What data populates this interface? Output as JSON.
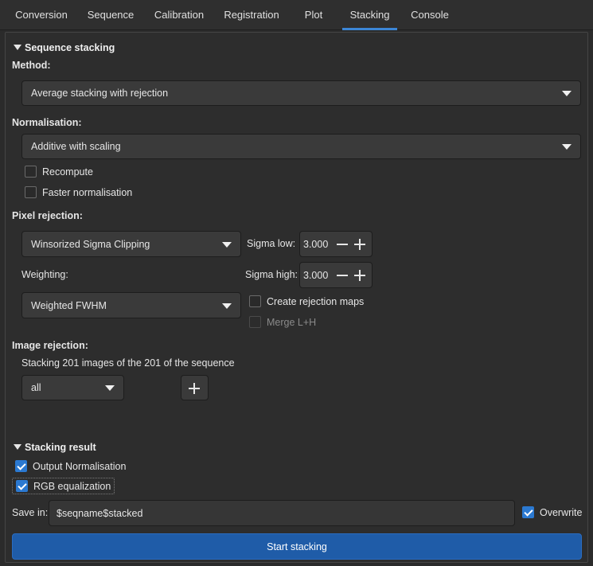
{
  "tabs": [
    {
      "label": "Conversion",
      "active": false
    },
    {
      "label": "Sequence",
      "active": false
    },
    {
      "label": "Calibration",
      "active": false
    },
    {
      "label": "Registration",
      "active": false
    },
    {
      "label": "Plot",
      "active": false
    },
    {
      "label": "Stacking",
      "active": true
    },
    {
      "label": "Console",
      "active": false
    }
  ],
  "sequence_stacking": {
    "title": "Sequence stacking",
    "method_label": "Method:",
    "method_value": "Average stacking with rejection",
    "normalisation_label": "Normalisation:",
    "normalisation_value": "Additive with scaling",
    "recompute_label": "Recompute",
    "recompute_checked": false,
    "faster_normalisation_label": "Faster normalisation",
    "faster_normalisation_checked": false
  },
  "pixel_rejection": {
    "title": "Pixel rejection:",
    "algorithm_value": "Winsorized Sigma Clipping",
    "sigma_low_label": "Sigma low:",
    "sigma_low_value": "3.000",
    "sigma_high_label": "Sigma high:",
    "sigma_high_value": "3.000",
    "weighting_label": "Weighting:",
    "weighting_value": "Weighted FWHM",
    "create_rejection_maps_label": "Create rejection maps",
    "create_rejection_maps_checked": false,
    "merge_lrgb_label": "Merge L+H",
    "merge_lrgb_checked": false,
    "merge_lrgb_disabled": true
  },
  "image_rejection": {
    "title": "Image rejection:",
    "summary": "Stacking 201 images of the 201 of the sequence",
    "filter_value": "all"
  },
  "stacking_result": {
    "title": "Stacking result",
    "output_normalisation_label": "Output Normalisation",
    "output_normalisation_checked": true,
    "rgb_equalization_label": "RGB equalization",
    "rgb_equalization_checked": true,
    "save_in_label": "Save in:",
    "save_in_value": "$seqname$stacked",
    "overwrite_label": "Overwrite",
    "overwrite_checked": true,
    "start_button_label": "Start stacking"
  },
  "colors": {
    "accent": "#2b79d1",
    "primary_button": "#1f5ca8",
    "background": "#2b2b2b"
  }
}
